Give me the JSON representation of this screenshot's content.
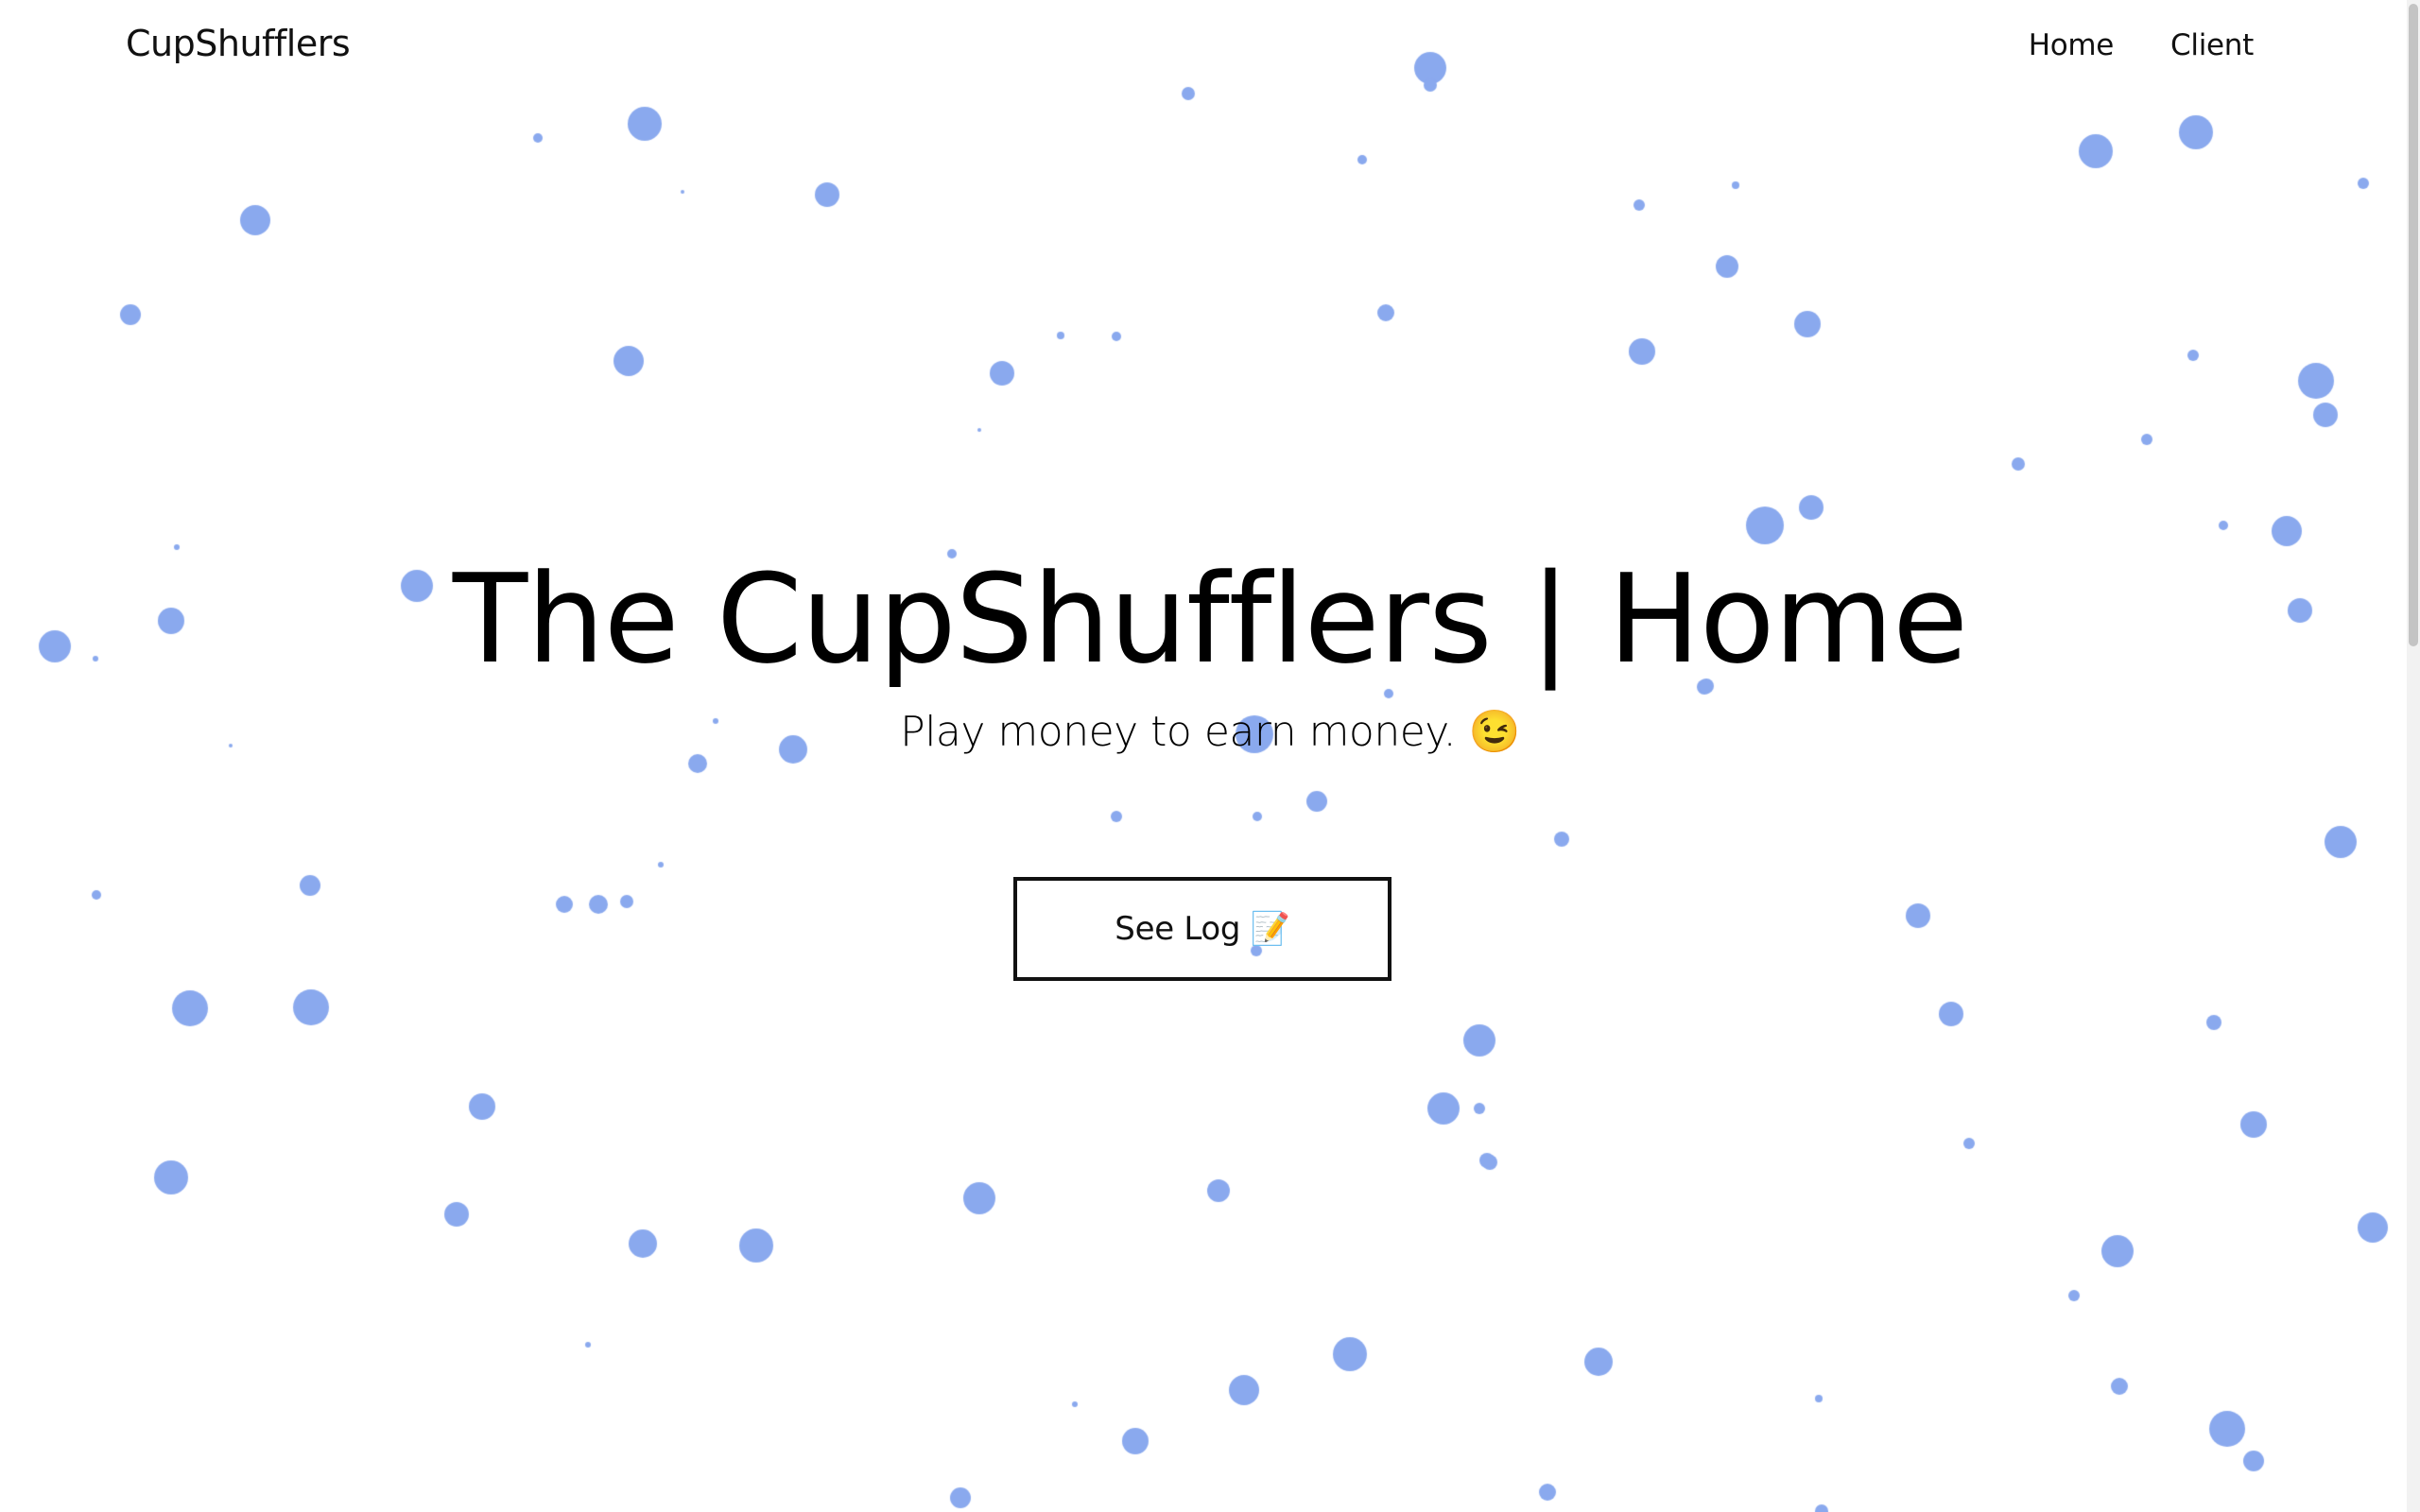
{
  "navbar": {
    "brand": "CupShufflers",
    "links": [
      {
        "label": "Home"
      },
      {
        "label": "Client"
      }
    ]
  },
  "hero": {
    "title": "The CupShufflers | Home",
    "subtitle": "Play money to earn money. 😉",
    "button_label": "See Log 📝"
  },
  "colors": {
    "particle": "#8aa9ee",
    "text": "#000000",
    "background": "#ffffff"
  }
}
